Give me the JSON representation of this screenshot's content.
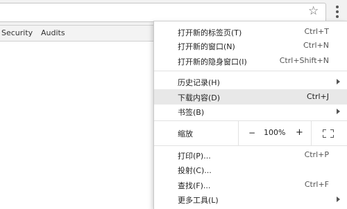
{
  "toolbar": {
    "bookmark_icon": "star-icon",
    "menu_icon": "three-dots-vertical-icon"
  },
  "devtools": {
    "tabs": [
      "Security",
      "Audits"
    ]
  },
  "menu": {
    "new_tab": {
      "label": "打开新的标签页(T)",
      "shortcut": "Ctrl+T"
    },
    "new_window": {
      "label": "打开新的窗口(N)",
      "shortcut": "Ctrl+N"
    },
    "incognito": {
      "label": "打开新的隐身窗口(I)",
      "shortcut": "Ctrl+Shift+N"
    },
    "history": {
      "label": "历史记录(H)"
    },
    "downloads": {
      "label": "下载内容(D)",
      "shortcut": "Ctrl+J"
    },
    "bookmarks": {
      "label": "书签(B)"
    },
    "zoom": {
      "label": "缩放",
      "minus": "−",
      "value": "100%",
      "plus": "+"
    },
    "print": {
      "label": "打印(P)...",
      "shortcut": "Ctrl+P"
    },
    "cast": {
      "label": "投射(C)..."
    },
    "find": {
      "label": "查找(F)...",
      "shortcut": "Ctrl+F"
    },
    "more_tools": {
      "label": "更多工具(L)"
    }
  }
}
